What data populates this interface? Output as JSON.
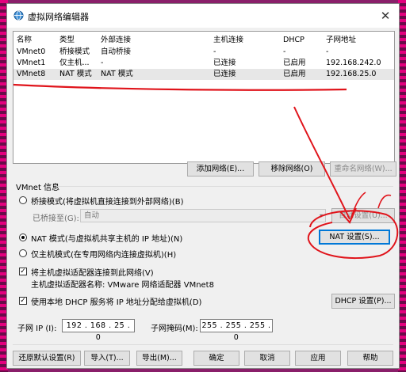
{
  "window": {
    "title": "虚拟网络编辑器",
    "close_glyph": "✕"
  },
  "table": {
    "headers": [
      "名称",
      "类型",
      "外部连接",
      "主机连接",
      "DHCP",
      "子网地址"
    ],
    "rows": [
      [
        "VMnet0",
        "桥接模式",
        "自动桥接",
        "-",
        "-",
        "-"
      ],
      [
        "VMnet1",
        "仅主机...",
        "-",
        "已连接",
        "已启用",
        "192.168.242.0"
      ],
      [
        "VMnet8",
        "NAT 模式",
        "NAT 模式",
        "已连接",
        "已启用",
        "192.168.25.0"
      ]
    ]
  },
  "table_buttons": {
    "add": "添加网络(E)...",
    "remove": "移除网络(O)",
    "rename": "重命名网络(W)..."
  },
  "vmnet_info": {
    "heading": "VMnet 信息",
    "bridge_radio": "桥接模式(将虚拟机直接连接到外部网络)(B)",
    "bridged_to_label": "已桥接至(G):",
    "bridged_to_value": "自动",
    "auto_settings": "自动设置(U)...",
    "nat_radio": "NAT 模式(与虚拟机共享主机的 IP 地址)(N)",
    "nat_settings": "NAT 设置(S)...",
    "hostonly_radio": "仅主机模式(在专用网络内连接虚拟机)(H)",
    "connect_adapter": "将主机虚拟适配器连接到此网络(V)",
    "adapter_name": "主机虚拟适配器名称: VMware 网络适配器 VMnet8",
    "use_dhcp": "使用本地 DHCP 服务将 IP 地址分配给虚拟机(D)",
    "dhcp_settings": "DHCP 设置(P)...",
    "subnet_ip_label": "子网 IP (I):",
    "subnet_ip": "192 . 168 . 25 . 0",
    "subnet_mask_label": "子网掩码(M):",
    "subnet_mask": "255 . 255 . 255 . 0",
    "check_glyph": "✓",
    "combo_arrow": "▾"
  },
  "footer": {
    "restore": "还原默认设置(R)",
    "import": "导入(T)...",
    "export": "导出(M)...",
    "ok": "确定",
    "cancel": "取消",
    "apply": "应用",
    "help": "帮助"
  },
  "colors": {
    "annotation_red": "#e0141b",
    "accent": "#0078d7"
  }
}
